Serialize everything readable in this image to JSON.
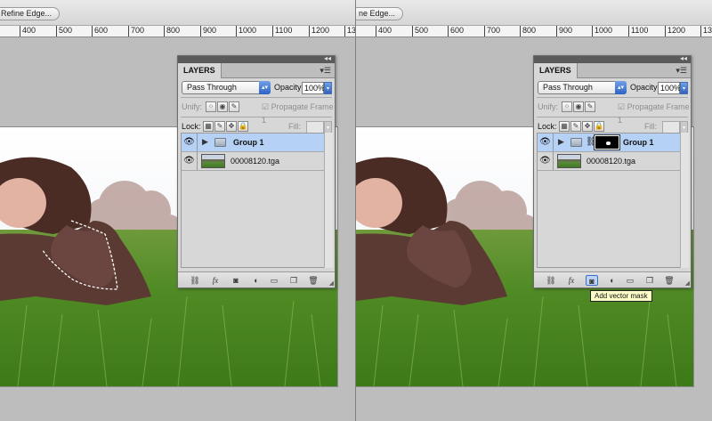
{
  "left": {
    "options_bar": {
      "refine_edge_label": "Refine Edge..."
    },
    "ruler_labels": [
      "400",
      "500",
      "600",
      "700",
      "800",
      "900",
      "1000",
      "1100",
      "1200",
      "130"
    ],
    "layers_panel": {
      "tab": "LAYERS",
      "blend_mode": "Pass Through",
      "opacity_label": "Opacity:",
      "opacity_value": "100%",
      "unify_label": "Unify:",
      "propagate_label": "Propagate Frame 1",
      "lock_label": "Lock:",
      "fill_label": "Fill:",
      "layers": [
        {
          "name": "Group 1",
          "selected": true
        },
        {
          "name": "00008120.tga",
          "selected": false
        }
      ]
    }
  },
  "right": {
    "options_bar": {
      "refine_edge_label": "ne Edge..."
    },
    "ruler_labels": [
      "400",
      "500",
      "600",
      "700",
      "800",
      "900",
      "1000",
      "1100",
      "1200",
      "130"
    ],
    "layers_panel": {
      "tab": "LAYERS",
      "blend_mode": "Pass Through",
      "opacity_label": "Opacity:",
      "opacity_value": "100%",
      "unify_label": "Unify:",
      "propagate_label": "Propagate Frame 1",
      "lock_label": "Lock:",
      "fill_label": "Fill:",
      "layers": [
        {
          "name": "Group 1",
          "selected": true
        },
        {
          "name": "00008120.tga",
          "selected": false
        }
      ]
    },
    "tooltip": "Add vector mask"
  },
  "icons": {
    "eye": "eye-icon",
    "folder": "folder-icon",
    "chain": "chain-link-icon",
    "lock": "lock-icon",
    "link": "link-layers-icon",
    "fx": "fx-icon",
    "mask": "add-mask-icon",
    "adjust": "adjustment-layer-icon",
    "newgroup": "new-group-icon",
    "newlayer": "new-layer-icon",
    "trash": "trash-icon"
  },
  "colors": {
    "selection": "#b5d1f6",
    "accent": "#2e63c4",
    "tooltip_bg": "#fdfdc8"
  }
}
